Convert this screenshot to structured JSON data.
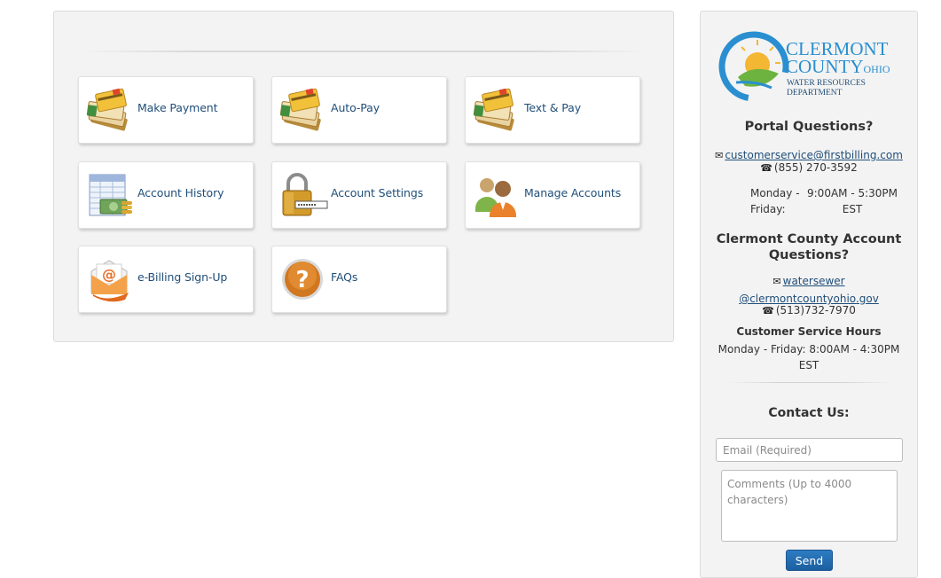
{
  "tiles": [
    {
      "label": "Make Payment",
      "icon": "credit-card-stack-icon"
    },
    {
      "label": "Auto-Pay",
      "icon": "credit-card-stack-icon"
    },
    {
      "label": "Text & Pay",
      "icon": "credit-card-stack-icon"
    },
    {
      "label": "Account History",
      "icon": "ledger-money-icon"
    },
    {
      "label": "Account Settings",
      "icon": "padlock-password-icon"
    },
    {
      "label": "Manage Accounts",
      "icon": "users-icon"
    },
    {
      "label": "e-Billing Sign-Up",
      "icon": "email-envelope-icon"
    },
    {
      "label": "FAQs",
      "icon": "question-mark-icon"
    }
  ],
  "logo": {
    "line1": "CLERMONT",
    "line2": "COUNTY",
    "line2_suffix": "OHIO",
    "line3": "WATER RESOURCES",
    "line4": "DEPARTMENT"
  },
  "portal": {
    "title": "Portal Questions?",
    "email": "customerservice@firstbilling.com",
    "phone": "(855) 270-3592",
    "hours_days_1": "Monday -",
    "hours_days_2": "Friday:",
    "hours_time_1": "9:00AM - 5:30PM",
    "hours_time_2": "EST"
  },
  "county": {
    "title_1": "Clermont County Account",
    "title_2": "Questions?",
    "email_1": "watersewer",
    "email_2": "@clermontcountyohio.gov",
    "phone": "(513)732-7970",
    "hours_title": "Customer Service Hours",
    "hours_1": "Monday - Friday: 8:00AM - 4:30PM",
    "hours_2": "EST"
  },
  "contact": {
    "title": "Contact Us:",
    "email_placeholder": "Email (Required)",
    "comments_placeholder": "Comments (Up to 4000 characters)",
    "send_label": "Send"
  },
  "colors": {
    "link": "#1f4e79",
    "panel_bg": "#f3f3f3",
    "button": "#1b5fa0"
  }
}
